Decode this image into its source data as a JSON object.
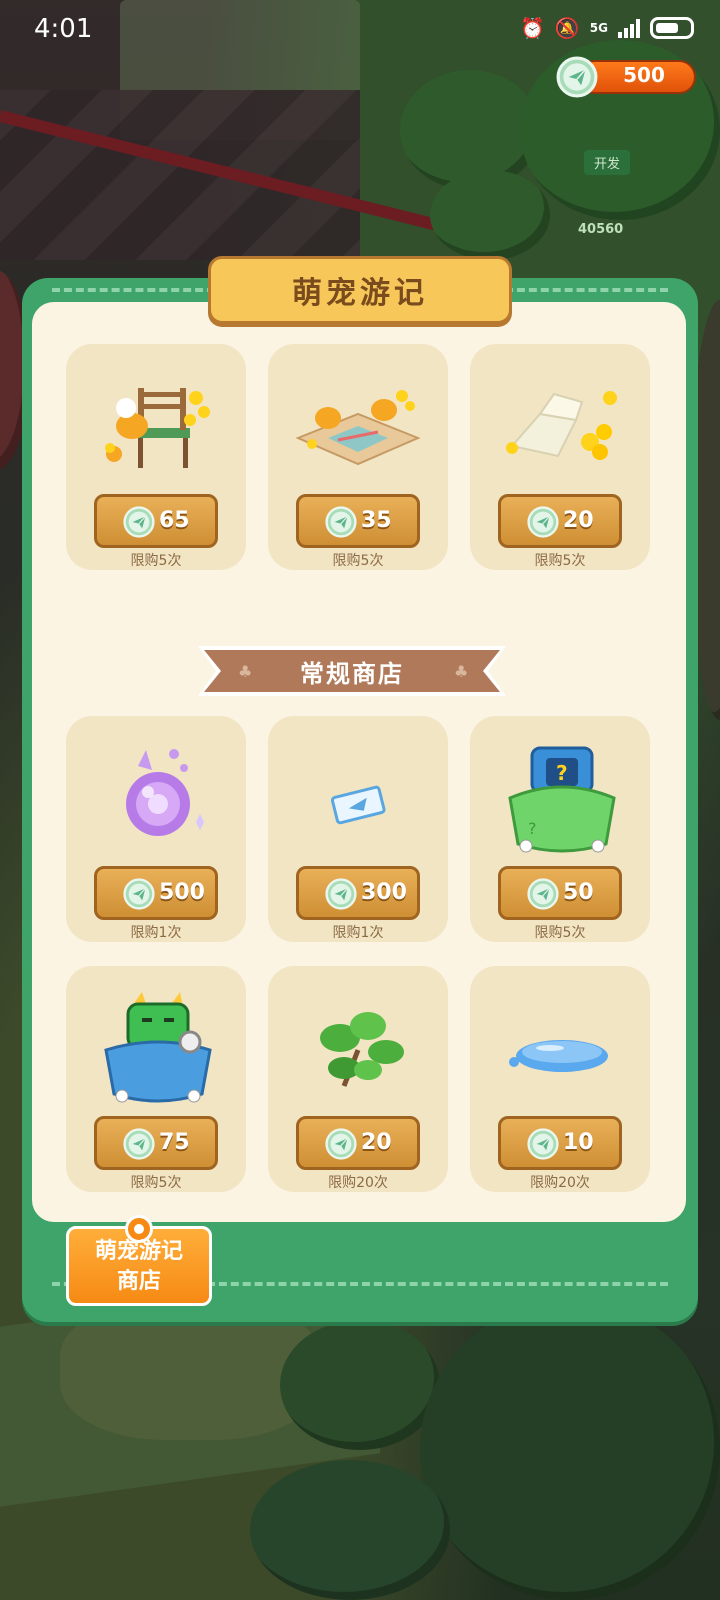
{
  "status_bar": {
    "time": "4:01",
    "network": "5G"
  },
  "currency": {
    "value": "500",
    "icon": "paper-plane-coin-icon"
  },
  "background": {
    "sign": "开发",
    "counter": "40560"
  },
  "panel": {
    "title": "萌宠游记",
    "section_title": "常规商店",
    "featured_items": [
      {
        "icon": "chick-chair-decor-icon",
        "price": "65",
        "limit": "限购5次"
      },
      {
        "icon": "chick-map-mat-icon",
        "price": "35",
        "limit": "限购5次"
      },
      {
        "icon": "white-flower-pillows-icon",
        "price": "20",
        "limit": "限购5次"
      }
    ],
    "regular_items": [
      {
        "icon": "purple-crystal-orb-icon",
        "price": "500",
        "limit": "限购1次"
      },
      {
        "icon": "blue-ticket-icon",
        "price": "300",
        "limit": "限购1次"
      },
      {
        "icon": "mystery-gift-bag-icon",
        "price": "50",
        "limit": "限购5次"
      },
      {
        "icon": "headphone-cat-bag-icon",
        "price": "75",
        "limit": "限购5次"
      },
      {
        "icon": "green-leaf-sprout-icon",
        "price": "20",
        "limit": "限购20次"
      },
      {
        "icon": "water-puddle-icon",
        "price": "10",
        "limit": "限购20次"
      }
    ],
    "shop_tab": {
      "line1": "萌宠游记",
      "line2": "商店"
    }
  },
  "colors": {
    "panel_green": "#3ea46a",
    "inner_cream": "#fbf4e3",
    "price_gold": "#d99a3e",
    "tab_orange": "#f68a14",
    "currency_orange": "#ff7a1a"
  }
}
